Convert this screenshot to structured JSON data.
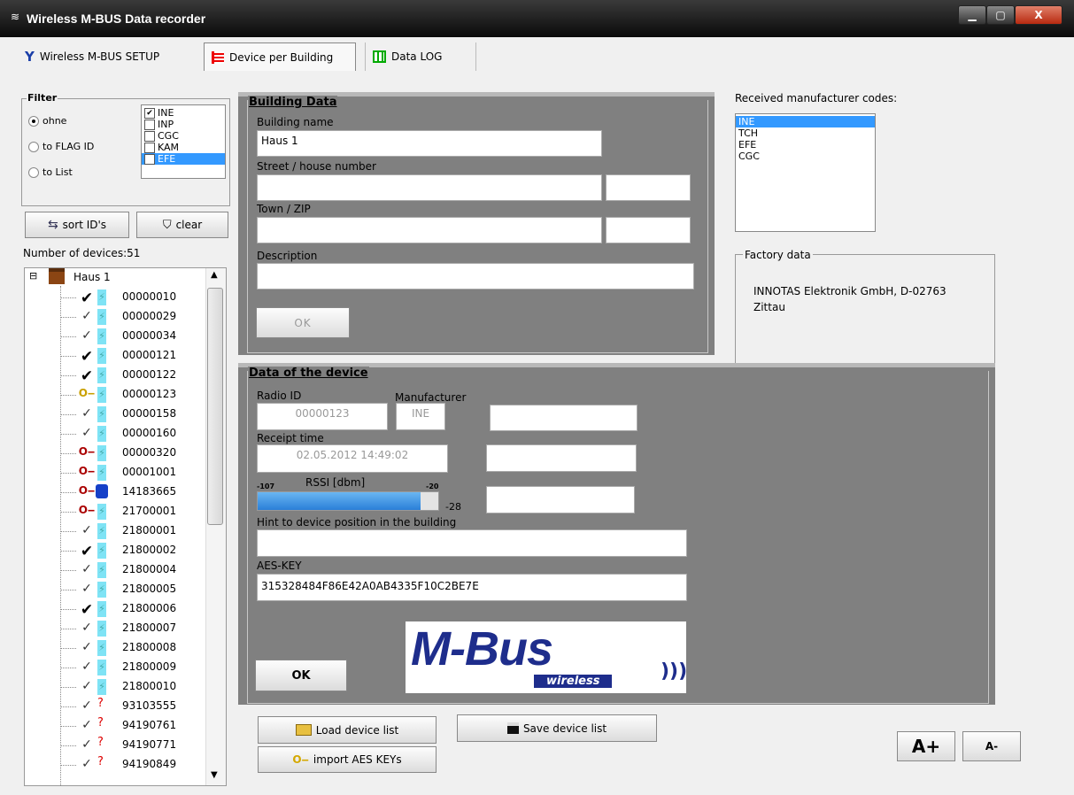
{
  "window": {
    "title": "Wireless M-BUS Data recorder",
    "minimize": "▁",
    "maximize": "▢",
    "close": "X"
  },
  "tabs": [
    {
      "label": "Wireless M-BUS SETUP",
      "icon": "antenna-icon"
    },
    {
      "label": "Device per Building",
      "icon": "list-icon"
    },
    {
      "label": "Data LOG",
      "icon": "grid-icon"
    }
  ],
  "filter": {
    "title": "Filter",
    "radios": [
      {
        "label": "ohne",
        "checked": true
      },
      {
        "label": "to FLAG ID",
        "checked": false
      },
      {
        "label": "to List",
        "checked": false
      }
    ],
    "codes": [
      {
        "code": "INE",
        "checked": true,
        "selected": false
      },
      {
        "code": "INP",
        "checked": false,
        "selected": false
      },
      {
        "code": "CGC",
        "checked": false,
        "selected": false
      },
      {
        "code": "KAM",
        "checked": false,
        "selected": false
      },
      {
        "code": "EFE",
        "checked": true,
        "selected": true
      }
    ]
  },
  "sort_button": "sort ID's",
  "clear_button": "clear",
  "device_count": "Number of devices:51",
  "tree": {
    "root": "Haus 1",
    "expander": "⊟",
    "devices": [
      {
        "id": "00000010",
        "status": "check-bold"
      },
      {
        "id": "00000029",
        "status": "check"
      },
      {
        "id": "00000034",
        "status": "check"
      },
      {
        "id": "00000121",
        "status": "check-bold"
      },
      {
        "id": "00000122",
        "status": "check-bold"
      },
      {
        "id": "00000123",
        "status": "key-yellow"
      },
      {
        "id": "00000158",
        "status": "check"
      },
      {
        "id": "00000160",
        "status": "check"
      },
      {
        "id": "00000320",
        "status": "key-red"
      },
      {
        "id": "00001001",
        "status": "key-red"
      },
      {
        "id": "14183665",
        "status": "key-red-radio"
      },
      {
        "id": "21700001",
        "status": "key-red"
      },
      {
        "id": "21800001",
        "status": "check"
      },
      {
        "id": "21800002",
        "status": "check-bold"
      },
      {
        "id": "21800004",
        "status": "check"
      },
      {
        "id": "21800005",
        "status": "check"
      },
      {
        "id": "21800006",
        "status": "check-bold"
      },
      {
        "id": "21800007",
        "status": "check"
      },
      {
        "id": "21800008",
        "status": "check"
      },
      {
        "id": "21800009",
        "status": "check"
      },
      {
        "id": "21800010",
        "status": "check"
      },
      {
        "id": "93103555",
        "status": "check-unknown"
      },
      {
        "id": "94190761",
        "status": "check-unknown"
      },
      {
        "id": "94190771",
        "status": "check-unknown"
      },
      {
        "id": "94190849",
        "status": "check-unknown"
      }
    ]
  },
  "building": {
    "title": "Building Data",
    "name_label": "Building name",
    "name_value": "Haus 1",
    "street_label": "Street / house number",
    "street_value": "",
    "number_value": "",
    "town_label": "Town / ZIP",
    "town_value": "",
    "zip_value": "",
    "desc_label": "Description",
    "desc_value": "",
    "ok": "OK"
  },
  "manufacturer_codes": {
    "title": "Received manufacturer codes:",
    "items": [
      "INE",
      "TCH",
      "EFE",
      "CGC"
    ],
    "selected": "INE"
  },
  "factory": {
    "title": "Factory data",
    "text": "INNOTAS Elektronik GmbH, D-02763 Zittau"
  },
  "device": {
    "title": "Data of the device",
    "radio_id_label": "Radio ID",
    "radio_id": "00000123",
    "manufacturer_label": "Manufacturer",
    "manufacturer": "INE",
    "receipt_label": "Receipt time",
    "receipt": "02.05.2012 14:49:02",
    "rssi_label": "RSSI [dbm]",
    "rssi_min": "-107",
    "rssi_max": "-20",
    "rssi_value": "-28",
    "rssi_fraction": 0.9,
    "hint_label": "Hint to device position in the building",
    "hint_value": "",
    "aes_label": "AES-KEY",
    "aes_value": "315328484F86E42A0AB4335F10C2BE7E",
    "ok": "OK"
  },
  "logo": {
    "main": "M-Bus",
    "sub": "wireless"
  },
  "buttons": {
    "load": "Load device list",
    "save": "Save device list",
    "import": "import AES KEYs",
    "font_plus": "A+",
    "font_minus": "A-"
  }
}
